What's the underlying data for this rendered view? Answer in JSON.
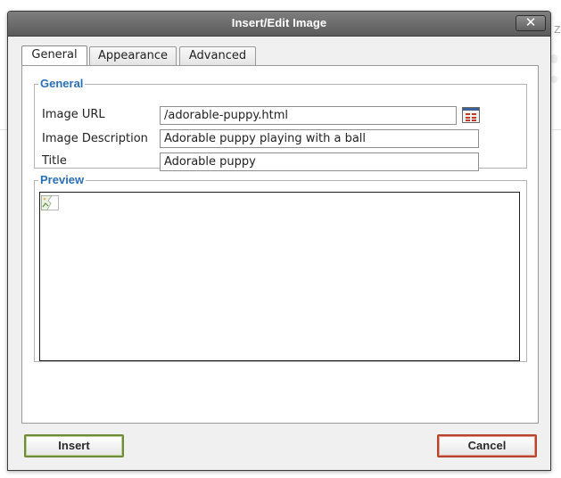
{
  "dialog": {
    "title": "Insert/Edit Image",
    "close_symbol": "✕",
    "close_icon": "close-icon"
  },
  "tabs": [
    {
      "label": "General",
      "active": true
    },
    {
      "label": "Appearance",
      "active": false
    },
    {
      "label": "Advanced",
      "active": false
    }
  ],
  "general": {
    "legend": "General",
    "image_url_label": "Image URL",
    "image_url_value": "/adorable-puppy.html",
    "browse_icon": "file-browser-icon",
    "image_description_label": "Image Description",
    "image_description_value": "Adorable puppy playing with a ball",
    "title_label": "Title",
    "title_value": "Adorable puppy"
  },
  "preview": {
    "legend": "Preview",
    "image_icon": "broken-image-icon"
  },
  "buttons": {
    "insert_label": "Insert",
    "cancel_label": "Cancel"
  },
  "background": {
    "edge_text": "Zo"
  },
  "colors": {
    "legend": "#2b6fb6",
    "titlebar": "#6b6b6b",
    "insert_border": "#6e8b3a",
    "cancel_border": "#b5452c"
  }
}
